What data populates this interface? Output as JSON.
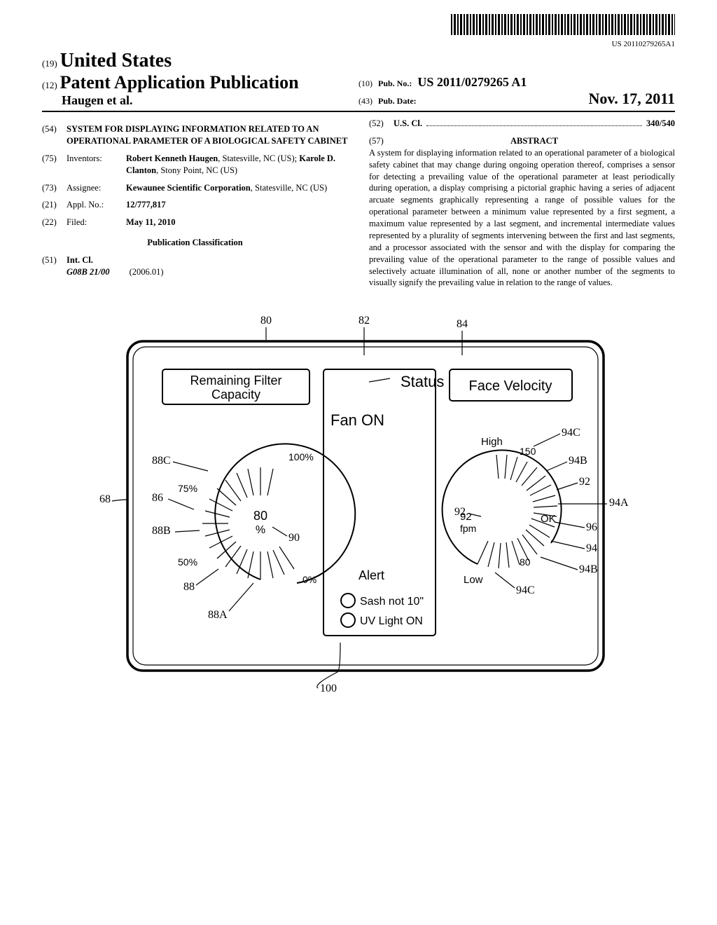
{
  "barcode_text": "US 20110279265A1",
  "header": {
    "country_prefix": "(19)",
    "country": "United States",
    "pub_type_prefix": "(12)",
    "pub_type": "Patent Application Publication",
    "author": "Haugen et al.",
    "pub_no_prefix": "(10)",
    "pub_no_label": "Pub. No.:",
    "pub_no": "US 2011/0279265 A1",
    "pub_date_prefix": "(43)",
    "pub_date_label": "Pub. Date:",
    "pub_date": "Nov. 17, 2011"
  },
  "left": {
    "title_num": "(54)",
    "title": "SYSTEM FOR DISPLAYING INFORMATION RELATED TO AN OPERATIONAL PARAMETER OF A BIOLOGICAL SAFETY CABINET",
    "inventors_num": "(75)",
    "inventors_label": "Inventors:",
    "inventors_val_pre1": "Robert Kenneth Haugen",
    "inventors_val_post1": ", Statesville, NC (US); ",
    "inventors_val_pre2": "Karole D. Clanton",
    "inventors_val_post2": ", Stony Point, NC (US)",
    "assignee_num": "(73)",
    "assignee_label": "Assignee:",
    "assignee_val_pre": "Kewaunee Scientific Corporation",
    "assignee_val_post": ", Statesville, NC (US)",
    "appl_num": "(21)",
    "appl_label": "Appl. No.:",
    "appl_val": "12/777,817",
    "filed_num": "(22)",
    "filed_label": "Filed:",
    "filed_val": "May 11, 2010",
    "pub_class": "Publication Classification",
    "intcl_num": "(51)",
    "intcl_label": "Int. Cl.",
    "intcl_code": "G08B 21/00",
    "intcl_year": "(2006.01)"
  },
  "right": {
    "uscl_num": "(52)",
    "uscl_label": "U.S. Cl.",
    "uscl_val": "340/540",
    "abstract_num": "(57)",
    "abstract_label": "ABSTRACT",
    "abstract_body": "A system for displaying information related to an operational parameter of a biological safety cabinet that may change during ongoing operation thereof, comprises a sensor for detecting a prevailing value of the operational parameter at least periodically during operation, a display comprising a pictorial graphic having a series of adjacent arcuate segments graphically representing a range of possible values for the operational parameter between a minimum value represented by a first segment, a maximum value represented by a last segment, and incremental intermediate values represented by a plurality of segments intervening between the first and last segments, and a processor associated with the sensor and with the display for comparing the prevailing value of the operational parameter to the range of possible values and selectively actuate illumination of all, none or another number of the segments to visually signify the prevailing value in relation to the range of values."
  },
  "figure": {
    "ref_68": "68",
    "ref_80_top": "80",
    "ref_82": "82",
    "ref_84": "84",
    "panel1_title1": "Remaining Filter",
    "panel1_title2": "Capacity",
    "p1_100": "100%",
    "p1_75": "75%",
    "p1_50": "50%",
    "p1_0": "0%",
    "p1_center1": "80",
    "p1_center2": "%",
    "ref_88C": "88C",
    "ref_86": "86",
    "ref_88B": "88B",
    "ref_88": "88",
    "ref_88A": "88A",
    "ref_90": "90",
    "panel2_title": "Status",
    "panel2_fan": "Fan ON",
    "panel2_alert": "Alert",
    "panel2_sash": "Sash not 10\"",
    "panel2_uv": "UV Light ON",
    "ref_100": "100",
    "panel3_title": "Face Velocity",
    "p3_high": "High",
    "p3_low": "Low",
    "p3_ok": "OK",
    "p3_150": "150",
    "p3_92": "92",
    "p3_fpm": "fpm",
    "p3_80": "80",
    "ref_94C_top": "94C",
    "ref_94B_top": "94B",
    "ref_92_r": "92",
    "ref_94A": "94A",
    "ref_92_l": "92",
    "ref_96": "96",
    "ref_94": "94",
    "ref_94B_bot": "94B",
    "ref_94C_bot": "94C"
  }
}
